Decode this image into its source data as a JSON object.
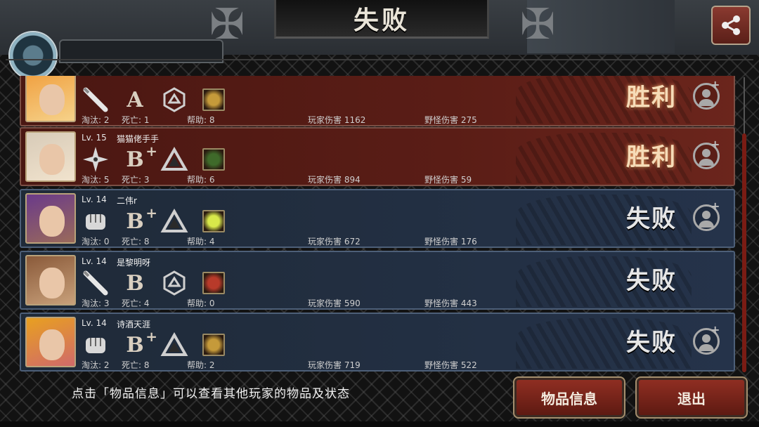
{
  "header": {
    "title": "失败",
    "behind_tab_text": ""
  },
  "players": [
    {
      "level": "",
      "name": "",
      "weapon_icon": "bat-icon",
      "grade": "A",
      "grade_plus": "",
      "skill_icon": "hexagon-rune-icon",
      "item_icon": "crosshair-item-icon",
      "eliminations": "淘汰: 2",
      "deaths": "死亡: 1",
      "assists": "帮助: 8",
      "player_damage": "玩家伤害 1162",
      "monster_damage": "野怪伤害 275",
      "result": "胜利",
      "state": "win",
      "avatar_colors": [
        "#f0a040",
        "#f6d28a"
      ],
      "item_color": "#c59a3a",
      "show_add": true
    },
    {
      "level": "Lv. 15",
      "name": "猫猫佬手手",
      "weapon_icon": "shuriken-icon",
      "grade": "B",
      "grade_plus": "+",
      "skill_icon": "triangle-rune-icon",
      "item_icon": "green-item-icon",
      "eliminations": "淘汰: 5",
      "deaths": "死亡: 3",
      "assists": "帮助: 6",
      "player_damage": "玩家伤害 894",
      "monster_damage": "野怪伤害 59",
      "result": "胜利",
      "state": "win",
      "avatar_colors": [
        "#d8cbb8",
        "#f1e3cd"
      ],
      "item_color": "#3f6a2a",
      "show_add": true
    },
    {
      "level": "Lv. 14",
      "name": "二伟r",
      "weapon_icon": "fist-icon",
      "grade": "B",
      "grade_plus": "+",
      "skill_icon": "triangle-rune-icon",
      "item_icon": "glow-item-icon",
      "eliminations": "淘汰: 0",
      "deaths": "死亡: 8",
      "assists": "帮助: 4",
      "player_damage": "玩家伤害 672",
      "monster_damage": "野怪伤害 176",
      "result": "失败",
      "state": "lose",
      "avatar_colors": [
        "#6a3a8a",
        "#9a6a5a"
      ],
      "item_color": "#d8e84a",
      "show_add": true
    },
    {
      "level": "Lv. 14",
      "name": "是黎明呀",
      "weapon_icon": "bat-icon",
      "grade": "B",
      "grade_plus": "",
      "skill_icon": "hexagon-rune-icon",
      "item_icon": "red-item-icon",
      "eliminations": "淘汰: 3",
      "deaths": "死亡: 4",
      "assists": "帮助: 0",
      "player_damage": "玩家伤害 590",
      "monster_damage": "野怪伤害 443",
      "result": "失败",
      "state": "lose",
      "avatar_colors": [
        "#8a5a3a",
        "#c8a07a"
      ],
      "item_color": "#b83a2a",
      "show_add": false
    },
    {
      "level": "Lv. 14",
      "name": "诗酒天涯",
      "weapon_icon": "fist-icon",
      "grade": "B",
      "grade_plus": "+",
      "skill_icon": "triangle-rune-icon",
      "item_icon": "crosshair-item-icon",
      "eliminations": "淘汰: 2",
      "deaths": "死亡: 8",
      "assists": "帮助: 2",
      "player_damage": "玩家伤害 719",
      "monster_damage": "野怪伤害 522",
      "result": "失败",
      "state": "lose",
      "avatar_colors": [
        "#e8a020",
        "#d06a6a"
      ],
      "item_color": "#c59a3a",
      "show_add": true
    }
  ],
  "footer": {
    "hint": "点击「物品信息」可以查看其他玩家的物品及状态",
    "items_button": "物品信息",
    "exit_button": "退出"
  },
  "colors": {
    "win_row": "#5a1d16",
    "lose_row": "#25334a",
    "button": "#8f2e22"
  }
}
